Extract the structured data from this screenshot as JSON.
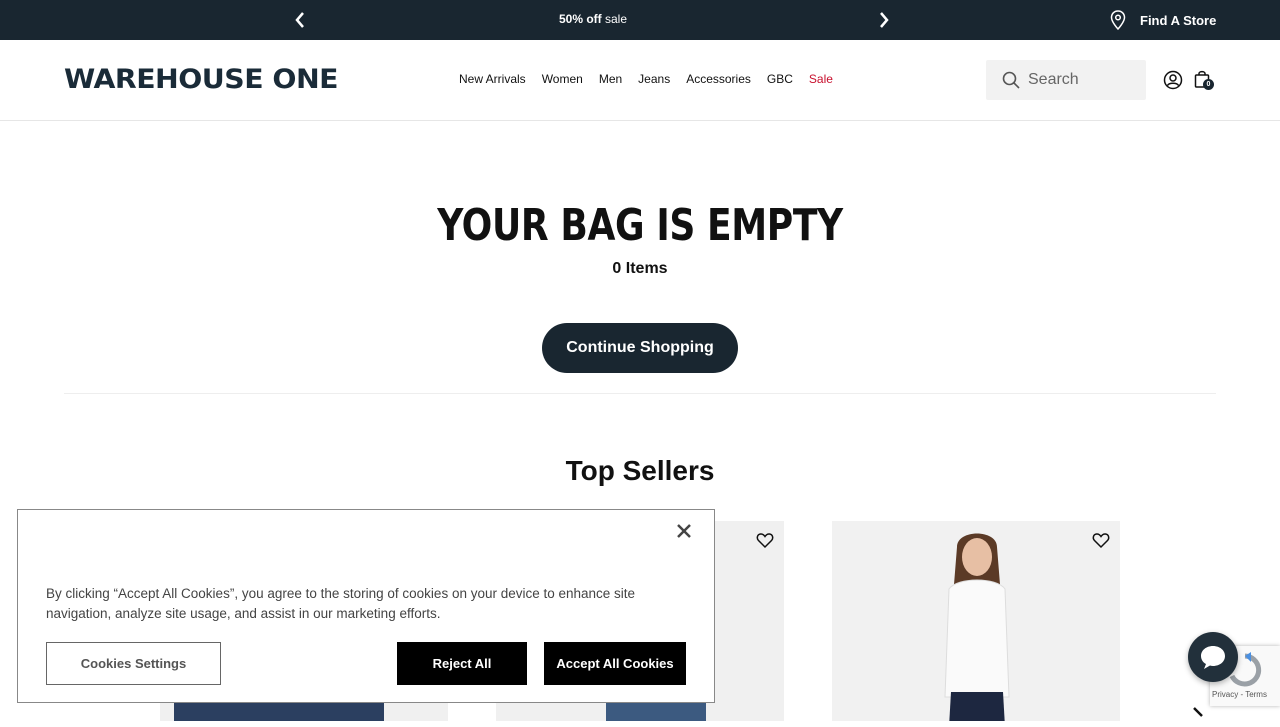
{
  "promo": {
    "message_bold": "50% off",
    "message_rest": " sale",
    "find_store": "Find A Store"
  },
  "header": {
    "logo": "WAREHOUSE ONE",
    "nav": [
      "New Arrivals",
      "Women",
      "Men",
      "Jeans",
      "Accessories",
      "GBC",
      "Sale"
    ],
    "search_placeholder": "Search",
    "bag_count": "0"
  },
  "main": {
    "title": "YOUR BAG IS EMPTY",
    "items_count": "0 Items",
    "continue_label": "Continue Shopping",
    "top_sellers": "Top Sellers"
  },
  "cookie": {
    "text": "By clicking “Accept All Cookies”, you agree to the storing of cookies on your device to enhance site navigation, analyze site usage, and assist in our marketing efforts.",
    "settings_label": "Cookies Settings",
    "reject_label": "Reject All",
    "accept_label": "Accept All Cookies"
  },
  "recaptcha": {
    "text": "Privacy - Terms"
  },
  "colors": {
    "navy": "#192630",
    "sale_red": "#c8102e"
  }
}
